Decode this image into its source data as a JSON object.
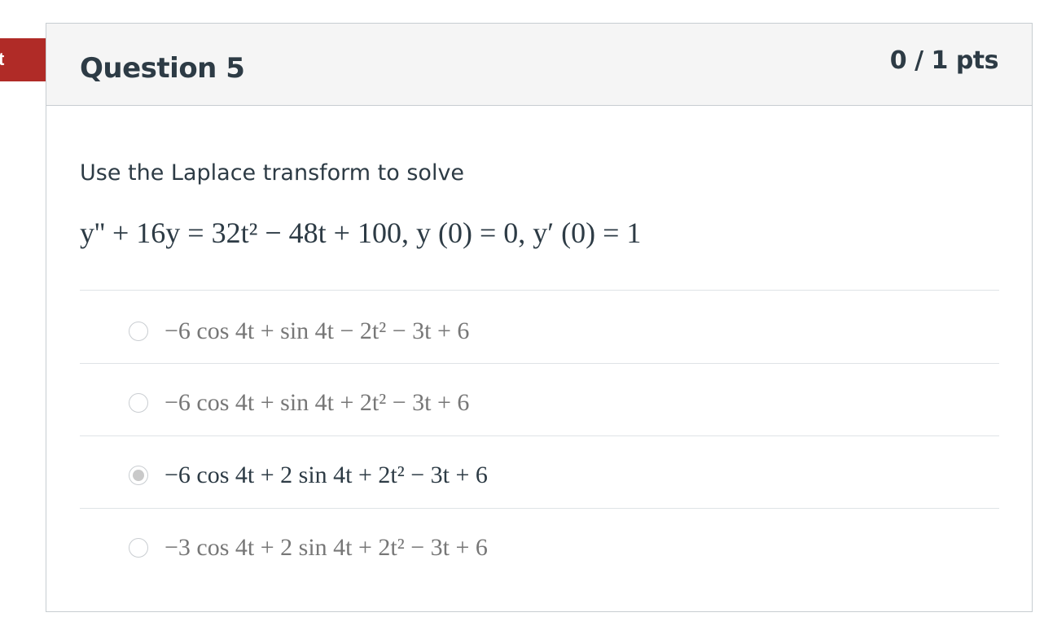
{
  "ribbon": {
    "label": "t"
  },
  "question": {
    "title": "Question 5",
    "points": "0 / 1 pts",
    "prompt": "Use the Laplace transform to solve",
    "equation": "y'' + 16y = 32t² − 48t + 100,  y (0) = 0,  y′ (0) = 1"
  },
  "answers": [
    {
      "label": "−6 cos 4t + sin 4t − 2t² − 3t + 6",
      "selected": false
    },
    {
      "label": "−6 cos 4t + sin 4t + 2t² − 3t + 6",
      "selected": false
    },
    {
      "label": "−6 cos 4t + 2 sin 4t + 2t² − 3t + 6",
      "selected": true
    },
    {
      "label": "−3 cos 4t + 2 sin 4t + 2t² − 3t + 6",
      "selected": false
    }
  ]
}
